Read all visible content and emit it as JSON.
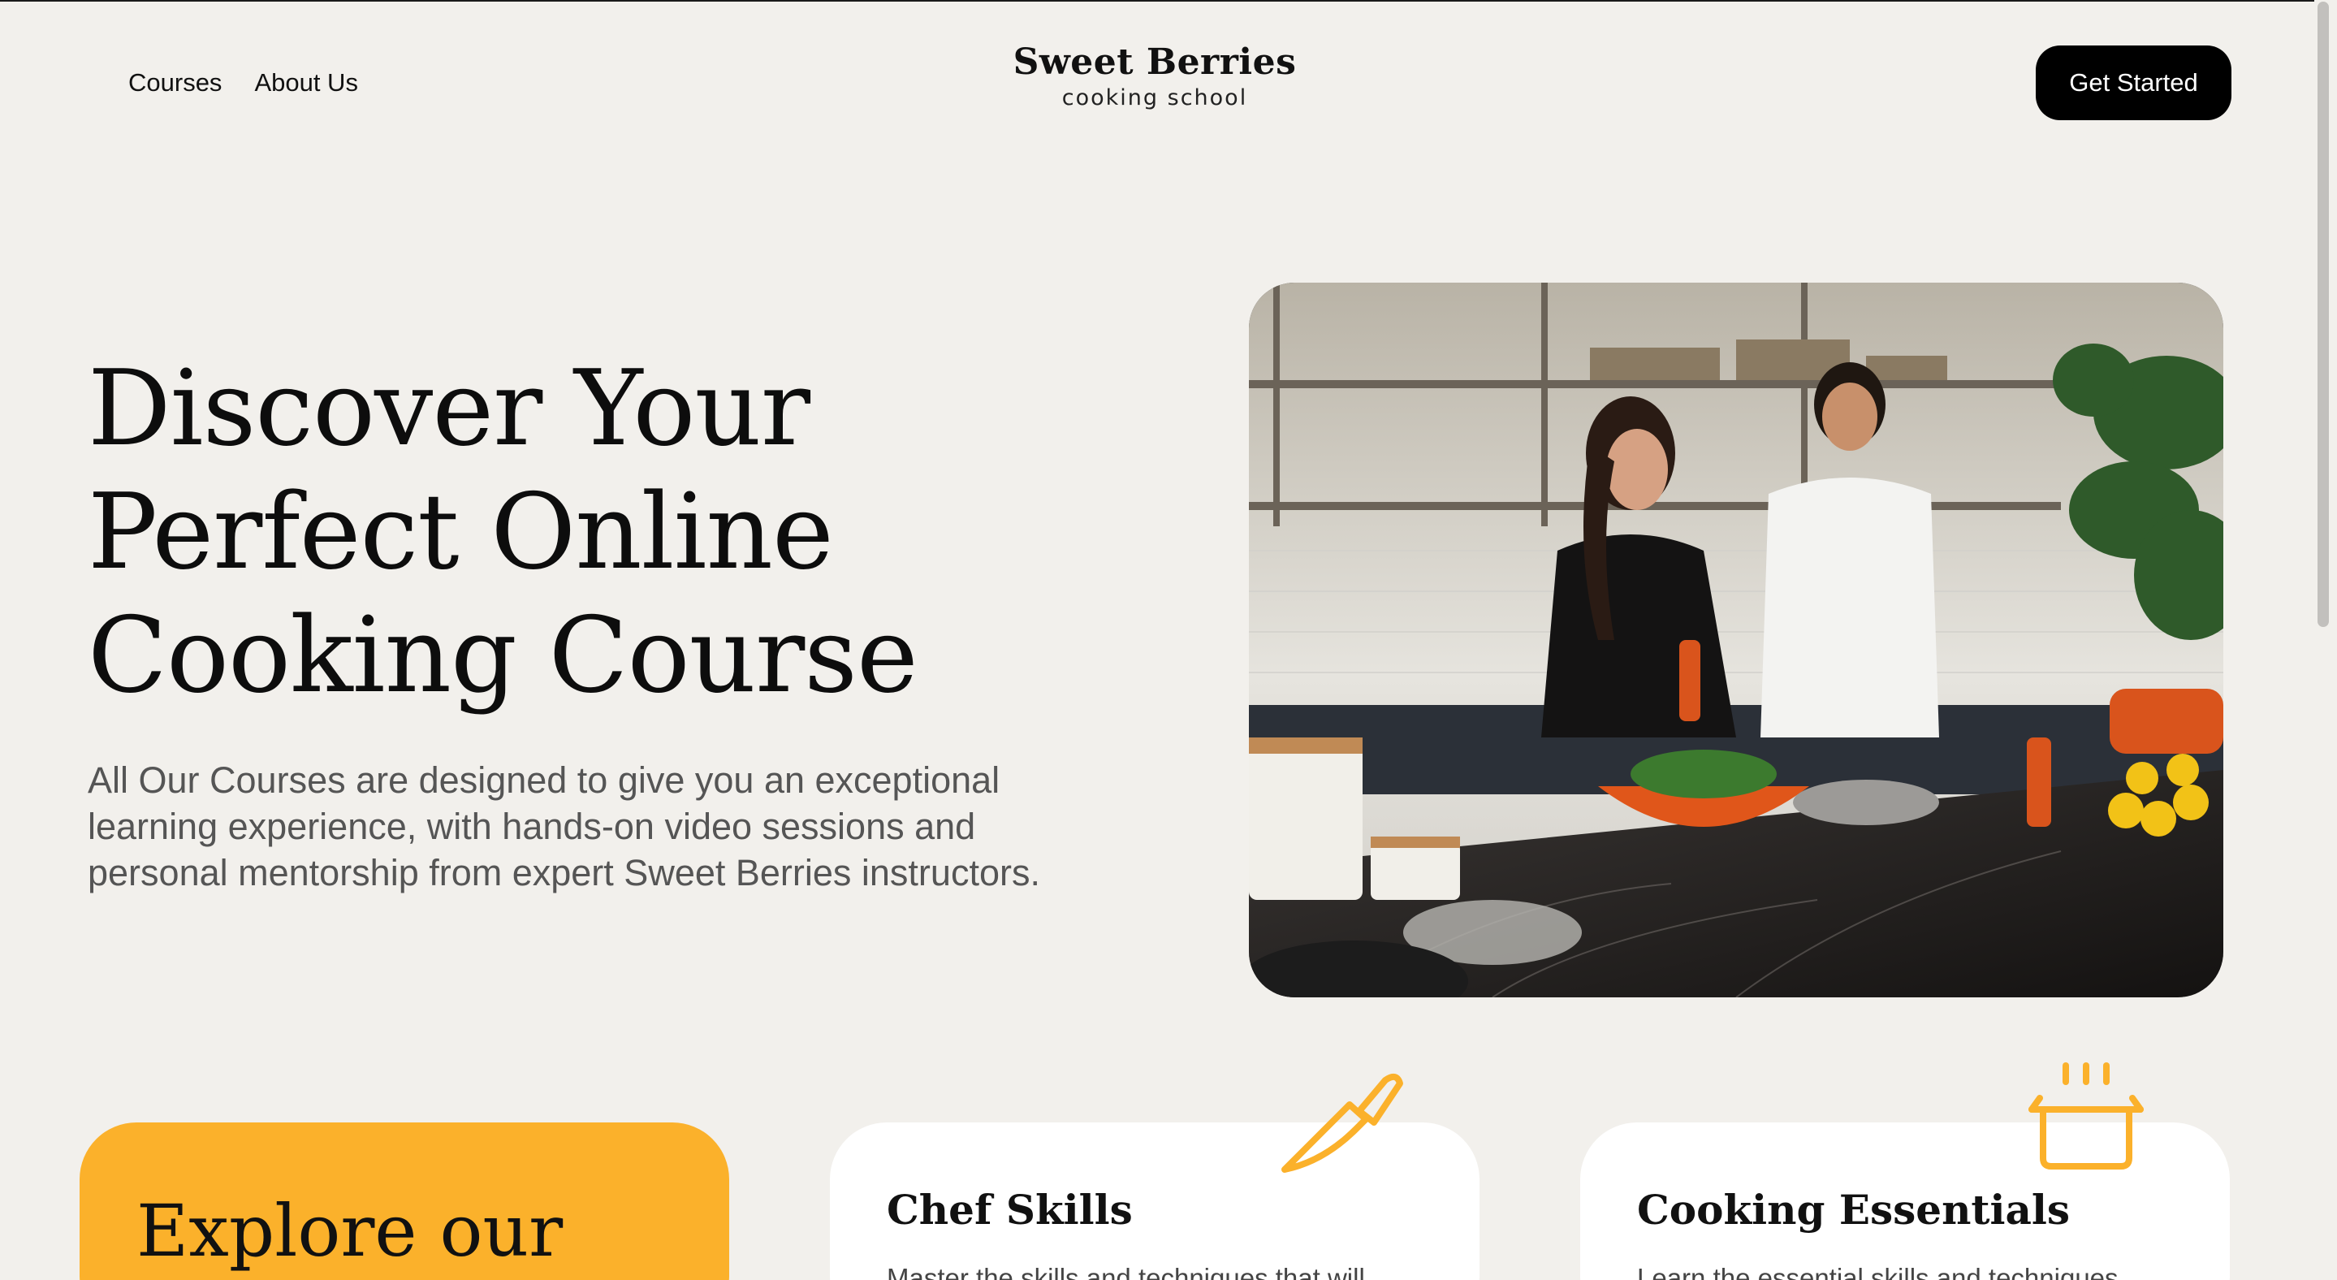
{
  "nav": {
    "links": [
      "Courses",
      "About Us"
    ],
    "cta_label": "Get Started"
  },
  "brand": {
    "name": "Sweet Berries",
    "tagline": "cooking school"
  },
  "hero": {
    "title_lines": [
      "Discover Your",
      "Perfect Online",
      "Cooking Course"
    ],
    "description": "All Our Courses are designed to give you an exceptional learning experience, with hands-on video sessions and personal mentorship from expert Sweet Berries instructors.",
    "image_icon": "hero-photo-cooking-couple"
  },
  "cards": [
    {
      "title": "Explore our",
      "desc": "",
      "icon": ""
    },
    {
      "title": "Chef Skills",
      "desc": "Master the skills and techniques that will",
      "icon": "knife-icon"
    },
    {
      "title": "Cooking Essentials",
      "desc": "Learn the essential skills and techniques",
      "icon": "pot-icon"
    }
  ],
  "colors": {
    "background": "#f2f0ec",
    "accent": "#fbb12b",
    "button": "#000000",
    "card": "#ffffff"
  }
}
